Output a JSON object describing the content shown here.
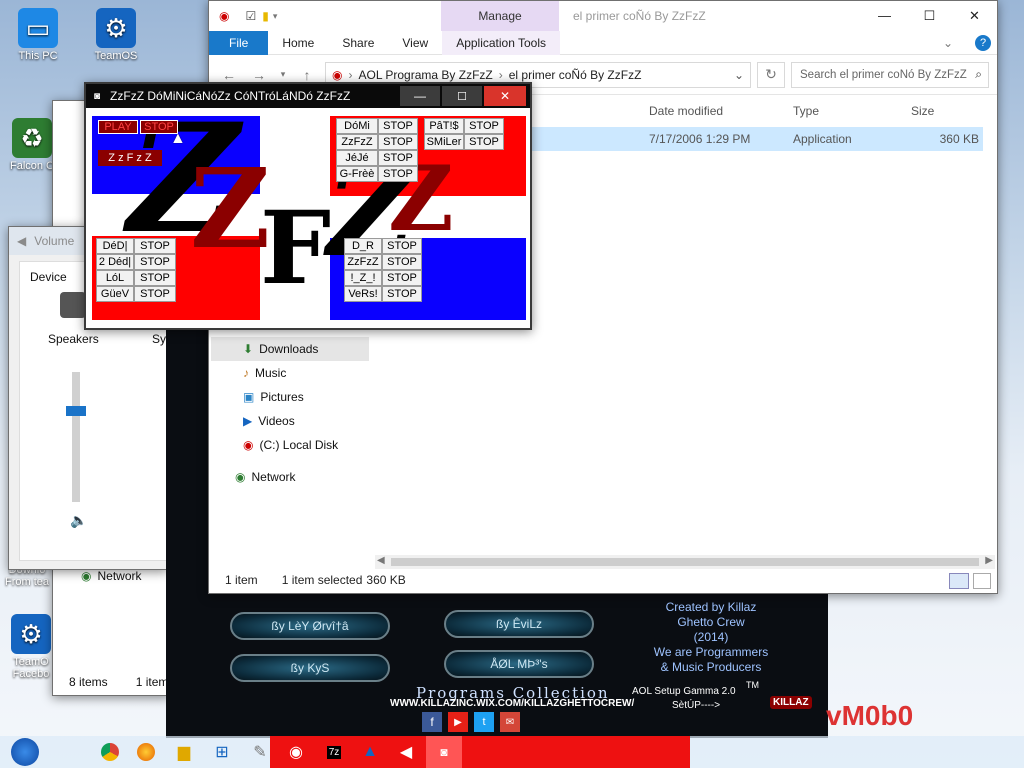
{
  "desktop": {
    "icons": [
      {
        "label": "This PC",
        "icon": "monitor-icon"
      },
      {
        "label": "TeamOS",
        "icon": "gear-icon"
      },
      {
        "label": "Falcon C",
        "icon": "recycle-icon"
      },
      {
        "label": "Downlo From tea",
        "icon": "folder-icon"
      },
      {
        "label": "TeamO Facebo",
        "icon": "gear-icon"
      }
    ]
  },
  "explorer": {
    "title": "el primer coÑó By ZzFzZ",
    "manage_tab": "Manage",
    "ribbon": [
      "File",
      "Home",
      "Share",
      "View",
      "Application Tools"
    ],
    "help": "?",
    "address": [
      "AOL Programa By ZzFzZ",
      "el primer coÑó By ZzFzZ"
    ],
    "search_placeholder": "Search el primer coÑó By ZzFzZ",
    "columns": [
      "Date modified",
      "Type",
      "Size"
    ],
    "row": {
      "date": "7/17/2006 1:29 PM",
      "type": "Application",
      "size": "360 KB"
    },
    "nav": [
      "Downloads",
      "Music",
      "Pictures",
      "Videos",
      "(C:) Local Disk",
      "Network"
    ],
    "status": {
      "count": "1 item",
      "selected": "1 item selected",
      "size": "360 KB"
    }
  },
  "app": {
    "title": "ZzFzZ DóMiNiCáNóZz CóNTróLáNDó ZzFzZ",
    "play": "PLAY",
    "stop": "STOP",
    "zzfzz_label": "Z z F z Z",
    "block1": [
      "DóMi",
      "ZzFzZ",
      "JéJé",
      "G-Frèè"
    ],
    "block2": [
      "PâT!$",
      "SMiLer"
    ],
    "block3": [
      "DéD|",
      "2 Déd|",
      "LóL",
      "GüeV"
    ],
    "block4": [
      "D_R",
      "ZzFzZ",
      "!_Z_!",
      "VeRs!"
    ],
    "bg_letters": [
      "Z",
      "Z",
      "F",
      "Z",
      "Z"
    ]
  },
  "volume": {
    "title": "Volume",
    "device": "Device",
    "speakers": "Speakers",
    "sys": "Sys",
    "level": 0.68
  },
  "bgwin": {
    "network": "Network",
    "items": "8 items",
    "item_sel": "1 item"
  },
  "killaz": {
    "credits": [
      "Created by Killaz",
      "Ghetto Crew",
      "(2014)",
      "We are Programmers",
      "& Music Producers"
    ],
    "buttons": [
      "ßy LèY Ørvî†â",
      "ßy ÊviLz",
      "ßy KyS",
      "ÅØL MÞ³'s"
    ],
    "banner": "Programs Collection",
    "url": "WWW.KILLAZINC.WIX.COM/KILLAZGHETTOCREW/",
    "setup": "SètÚP---->",
    "setup2": "AOL Setup Gamma 2.0",
    "tm": "TM",
    "logo": "KILLAZ"
  },
  "decor": {
    "vm": "vM0b0"
  },
  "colors": {
    "accent": "#1979ca",
    "manage_bg": "#e6d9f3",
    "red": "#ff0000",
    "blue": "#0a00ff"
  }
}
